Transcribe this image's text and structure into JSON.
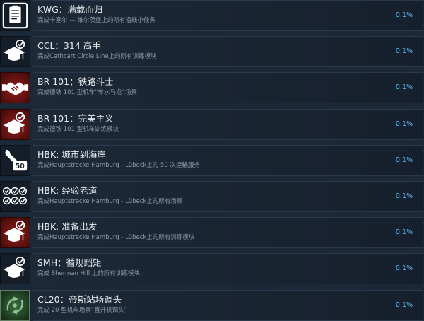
{
  "achievements": [
    {
      "title": "KWG：满载而归",
      "description": "完成卡塞尔 — 维尔茨堡上的所有沿线小任务",
      "percent": "0.1%",
      "icon": "clipboard-icon",
      "icon_style": "dark"
    },
    {
      "title": "CCL：314 高手",
      "description": "完成Cathcart Circle Line上的所有训练模块",
      "percent": "0.1%",
      "icon": "graduation-cap-check-icon",
      "icon_style": "dark"
    },
    {
      "title": "BR 101：铁路斗士",
      "description": "完成德铁 101 型机车“车水马龙”场景",
      "percent": "0.1%",
      "icon": "handshake-icon",
      "icon_style": "red"
    },
    {
      "title": "BR 101：完美主义",
      "description": "完成德铁 101 型机车训练模块",
      "percent": "0.1%",
      "icon": "graduation-cap-check-icon",
      "icon_style": "red"
    },
    {
      "title": "HBK: 城市到海岸",
      "description": "完成Hauptstrecke Hamburg - Lübeck上的 50 次运输服务",
      "percent": "0.1%",
      "icon": "wrench-50-icon",
      "icon_style": "dark",
      "icon_text": "50"
    },
    {
      "title": "HBK: 经验老道",
      "description": "完成Hauptstrecke Hamburg - Lübeck上的所有场景",
      "percent": "0.1%",
      "icon": "multi-check-icon",
      "icon_style": "dark"
    },
    {
      "title": "HBK: 准备出发",
      "description": "完成Hauptstrecke Hamburg - Lübeck上的所有训练模块",
      "percent": "0.1%",
      "icon": "graduation-cap-check-icon",
      "icon_style": "red"
    },
    {
      "title": "SMH：循规蹈矩",
      "description": "完成 Sherman Hill 上的所有训练模块",
      "percent": "0.1%",
      "icon": "graduation-cap-check-icon",
      "icon_style": "dark"
    },
    {
      "title": "CL20：帝斯站场调头",
      "description": "完成 20 型机车场景“直升机调头”",
      "percent": "0.1%",
      "icon": "turn-arrows-icon",
      "icon_style": "green"
    }
  ],
  "colors": {
    "background": "#1b2838",
    "percent": "#66c0f4",
    "title": "#e6eaee",
    "description": "#8b98a5",
    "icon_red": "#7a1a17",
    "icon_green": "#2d5530"
  }
}
